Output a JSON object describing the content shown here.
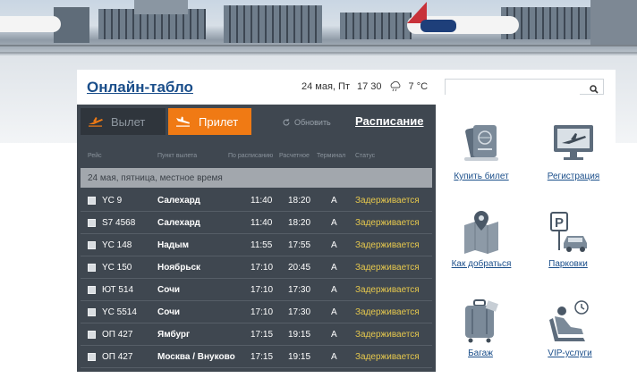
{
  "header": {
    "title": "Онлайн-табло",
    "date": "24 мая, Пт",
    "time": "17  30",
    "temperature": "7 °C",
    "weather_icon": "cloud-rain-icon",
    "search": {
      "placeholder": "",
      "value": ""
    }
  },
  "board": {
    "tabs": [
      {
        "label": "Вылет",
        "icon": "plane-departure-icon",
        "active": false
      },
      {
        "label": "Прилет",
        "icon": "plane-arrival-icon",
        "active": true
      }
    ],
    "refresh_label": "Обновить",
    "schedule_label": "Расписание",
    "columns": {
      "flight": "Рейс",
      "origin": "Пункт вылета",
      "scheduled": "По расписанию",
      "estimated": "Расчетное",
      "terminal": "Терминал",
      "status": "Статус"
    },
    "date_row": "24 мая, пятница, местное время",
    "flights": [
      {
        "flight": "YC 9",
        "city": "Салехард",
        "scheduled": "11:40",
        "estimated": "18:20",
        "terminal": "A",
        "status": "Задерживается"
      },
      {
        "flight": "S7 4568",
        "city": "Салехард",
        "scheduled": "11:40",
        "estimated": "18:20",
        "terminal": "A",
        "status": "Задерживается"
      },
      {
        "flight": "YC 148",
        "city": "Надым",
        "scheduled": "11:55",
        "estimated": "17:55",
        "terminal": "A",
        "status": "Задерживается"
      },
      {
        "flight": "YC 150",
        "city": "Ноябрьск",
        "scheduled": "17:10",
        "estimated": "20:45",
        "terminal": "A",
        "status": "Задерживается"
      },
      {
        "flight": "ЮТ 514",
        "city": "Сочи",
        "scheduled": "17:10",
        "estimated": "17:30",
        "terminal": "A",
        "status": "Задерживается"
      },
      {
        "flight": "YC 5514",
        "city": "Сочи",
        "scheduled": "17:10",
        "estimated": "17:30",
        "terminal": "A",
        "status": "Задерживается"
      },
      {
        "flight": "ОП 427",
        "city": "Ямбург",
        "scheduled": "17:15",
        "estimated": "19:15",
        "terminal": "A",
        "status": "Задерживается"
      },
      {
        "flight": "ОП 427",
        "city": "Москва / Внуково",
        "scheduled": "17:15",
        "estimated": "19:15",
        "terminal": "A",
        "status": "Задерживается"
      }
    ]
  },
  "services": [
    {
      "label": "Купить билет",
      "icon": "passport-ticket-icon"
    },
    {
      "label": "Регистрация",
      "icon": "monitor-plane-icon"
    },
    {
      "label": "Как добраться",
      "icon": "map-pin-icon"
    },
    {
      "label": "Парковки",
      "icon": "parking-car-icon"
    },
    {
      "label": "Багаж",
      "icon": "luggage-icon"
    },
    {
      "label": "VIP-услуги",
      "icon": "vip-seat-icon"
    }
  ],
  "colors": {
    "accent": "#f07a14",
    "link": "#1a4e8a",
    "board_bg": "#3f4750",
    "status_delayed": "#e6c84d"
  }
}
